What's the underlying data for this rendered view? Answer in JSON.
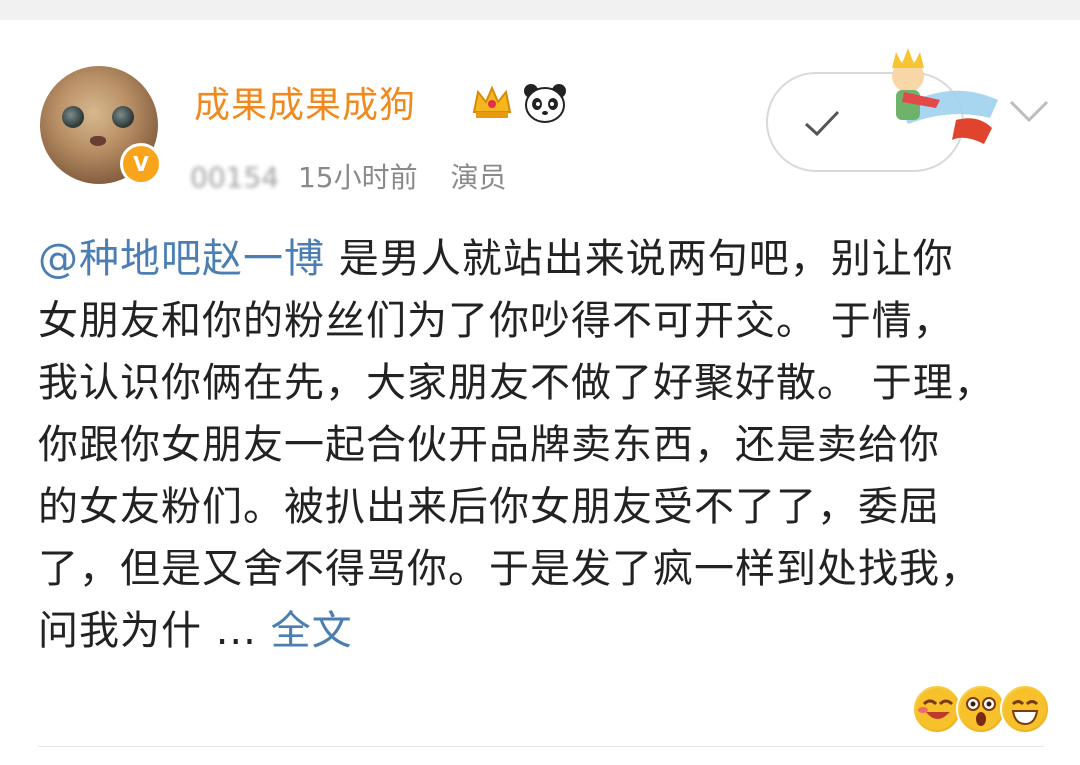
{
  "post": {
    "username": "成果成果成狗",
    "meta_blur": "00154",
    "time": "15小时前",
    "role": "演员",
    "mention": "@种地吧赵一博",
    "lines": [
      " 是男人就站出来说两句吧，别让你",
      "女朋友和你的粉丝们为了你吵得不可开交。 于情，",
      "我认识你俩在先，大家朋友不做了好聚好散。 于理，",
      "你跟你女朋友一起合伙开品牌卖东西，还是卖给你",
      "的女友粉们。被扒出来后你女朋友受不了了，委屈",
      "了，但是又舍不得骂你。于是发了疯一样到处找我，",
      "问我为什 ... "
    ],
    "more_label": "全文"
  },
  "badges": {
    "verified": "V"
  },
  "icons": {
    "crown": "crown-icon",
    "panda": "panda-icon",
    "follow_check": "check-icon",
    "prince": "prince-icon",
    "menu": "chevron-down-icon",
    "reactions": [
      "laugh-emoji-icon",
      "shocked-emoji-icon",
      "grin-emoji-icon"
    ]
  },
  "colors": {
    "username": "#f08a1e",
    "link": "#4b7fb4",
    "body_text": "#222222",
    "meta_text": "#8a8a8a",
    "verified_badge": "#f8a51c"
  }
}
